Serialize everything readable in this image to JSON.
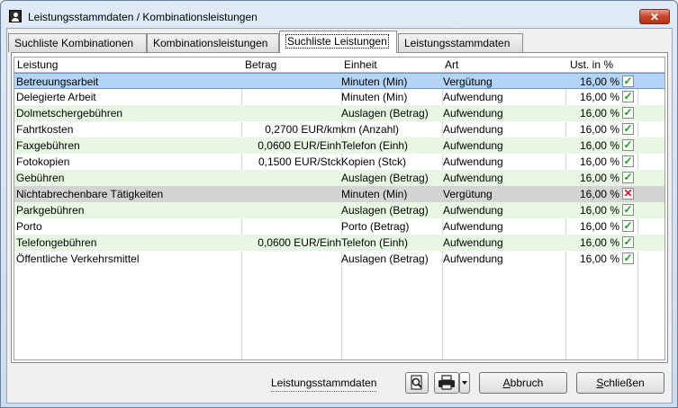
{
  "window": {
    "title": "Leistungsstammdaten / Kombinationsleistungen",
    "close_label": "✕"
  },
  "tabs": [
    {
      "label": "Suchliste Kombinationen"
    },
    {
      "label": "Kombinationsleistungen"
    },
    {
      "label": "Suchliste Leistungen",
      "active": true
    },
    {
      "label": "Leistungsstammdaten"
    }
  ],
  "table": {
    "columns": [
      "Leistung",
      "Betrag",
      "Einheit",
      "Art",
      "Ust. in %"
    ],
    "rows": [
      {
        "leistung": "Betreuungsarbeit",
        "betrag": "",
        "einheit": "Minuten (Min)",
        "art": "Vergütung",
        "ust": "16,00 %",
        "active": true,
        "state": "selected"
      },
      {
        "leistung": "Delegierte Arbeit",
        "betrag": "",
        "einheit": "Minuten (Min)",
        "art": "Aufwendung",
        "ust": "16,00 %",
        "active": true,
        "state": "white"
      },
      {
        "leistung": "Dolmetschergebühren",
        "betrag": "",
        "einheit": "Auslagen (Betrag)",
        "art": "Aufwendung",
        "ust": "16,00 %",
        "active": true,
        "state": "green"
      },
      {
        "leistung": "Fahrtkosten",
        "betrag": "0,2700 EUR/km",
        "einheit": "km (Anzahl)",
        "art": "Aufwendung",
        "ust": "16,00 %",
        "active": true,
        "state": "white"
      },
      {
        "leistung": "Faxgebühren",
        "betrag": "0,0600 EUR/Einh",
        "einheit": "Telefon (Einh)",
        "art": "Aufwendung",
        "ust": "16,00 %",
        "active": true,
        "state": "green"
      },
      {
        "leistung": "Fotokopien",
        "betrag": "0,1500 EUR/Stck",
        "einheit": "Kopien (Stck)",
        "art": "Aufwendung",
        "ust": "16,00 %",
        "active": true,
        "state": "white"
      },
      {
        "leistung": "Gebühren",
        "betrag": "",
        "einheit": "Auslagen (Betrag)",
        "art": "Aufwendung",
        "ust": "16,00 %",
        "active": true,
        "state": "green"
      },
      {
        "leistung": "Nichtabrechenbare Tätigkeiten",
        "betrag": "",
        "einheit": "Minuten (Min)",
        "art": "Vergütung",
        "ust": "16,00 %",
        "active": false,
        "state": "grey"
      },
      {
        "leistung": "Parkgebühren",
        "betrag": "",
        "einheit": "Auslagen (Betrag)",
        "art": "Aufwendung",
        "ust": "16,00 %",
        "active": true,
        "state": "green"
      },
      {
        "leistung": "Porto",
        "betrag": "",
        "einheit": "Porto (Betrag)",
        "art": "Aufwendung",
        "ust": "16,00 %",
        "active": true,
        "state": "white"
      },
      {
        "leistung": "Telefongebühren",
        "betrag": "0,0600 EUR/Einh",
        "einheit": "Telefon (Einh)",
        "art": "Aufwendung",
        "ust": "16,00 %",
        "active": true,
        "state": "green"
      },
      {
        "leistung": "Öffentliche Verkehrsmittel",
        "betrag": "",
        "einheit": "Auslagen (Betrag)",
        "art": "Aufwendung",
        "ust": "16,00 %",
        "active": true,
        "state": "white"
      }
    ]
  },
  "footer": {
    "link_label": "Leistungsstammdaten",
    "cancel_label": "Abbruch",
    "close_label": "Schließen"
  },
  "colors": {
    "selected_row": "#b4d4f6",
    "alt_row": "#e7f7e1",
    "inactive_row": "#d4d4d4",
    "check_green": "#1aa31a",
    "cross_red": "#e0102a"
  },
  "icons": {
    "window": "user-icon",
    "search": "search-document-icon",
    "print": "printer-icon",
    "dropdown": "dropdown-arrow-icon"
  }
}
